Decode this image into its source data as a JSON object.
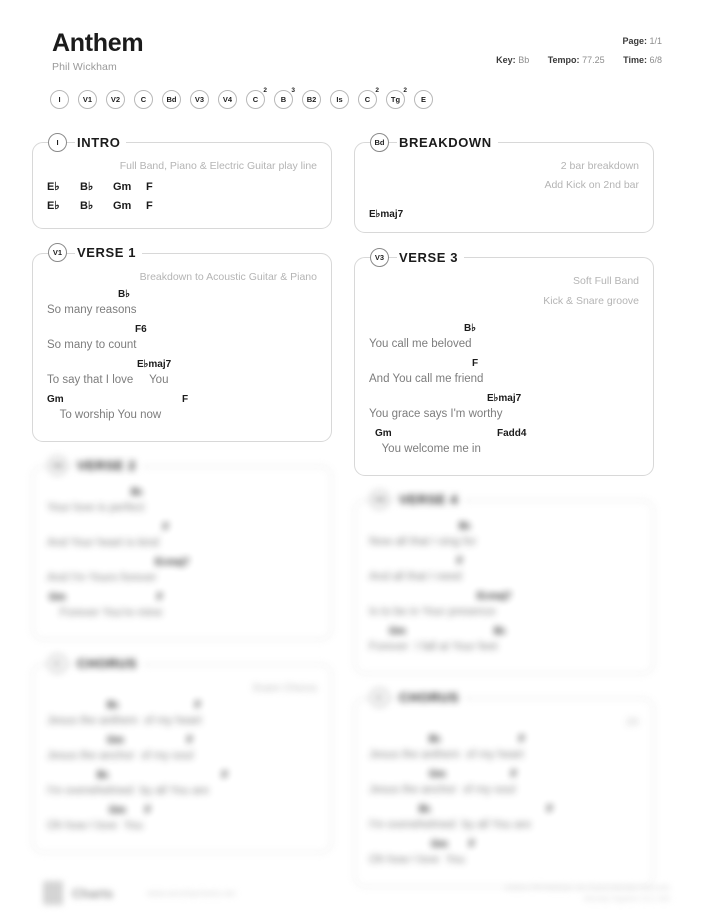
{
  "header": {
    "title": "Anthem",
    "artist": "Phil Wickham",
    "page_label": "Page:",
    "page_value": "1/1",
    "key_label": "Key:",
    "key_value": "Bb",
    "tempo_label": "Tempo:",
    "tempo_value": "77.25",
    "time_label": "Time:",
    "time_value": "6/8"
  },
  "badge_strip": [
    {
      "label": "I",
      "sup": ""
    },
    {
      "label": "V1",
      "sup": ""
    },
    {
      "label": "V2",
      "sup": ""
    },
    {
      "label": "C",
      "sup": ""
    },
    {
      "label": "Bd",
      "sup": ""
    },
    {
      "label": "V3",
      "sup": ""
    },
    {
      "label": "V4",
      "sup": ""
    },
    {
      "label": "C",
      "sup": "2"
    },
    {
      "label": "B",
      "sup": "3"
    },
    {
      "label": "B2",
      "sup": ""
    },
    {
      "label": "Is",
      "sup": ""
    },
    {
      "label": "C",
      "sup": "2"
    },
    {
      "label": "Tg",
      "sup": "2"
    },
    {
      "label": "E",
      "sup": ""
    }
  ],
  "sections": {
    "intro": {
      "badge": "I",
      "title": "INTRO",
      "note": "Full Band, Piano & Electric Guitar play line",
      "chord_rows": [
        [
          "E♭",
          "B♭",
          "Gm",
          "F"
        ],
        [
          "E♭",
          "B♭",
          "Gm",
          "F"
        ]
      ]
    },
    "breakdown": {
      "badge": "Bd",
      "title": "BREAKDOWN",
      "note_line1": "2 bar breakdown",
      "note_line2": "Add Kick on 2nd bar",
      "chord": "E♭maj7"
    },
    "verse1": {
      "badge": "V1",
      "title": "VERSE 1",
      "note": "Breakdown to Acoustic Guitar & Piano",
      "lines": [
        {
          "lyric": "So many reasons",
          "chords": [
            {
              "text": "B♭",
              "offset": 71
            }
          ]
        },
        {
          "lyric": "So many to count",
          "chords": [
            {
              "text": "F6",
              "offset": 88
            }
          ]
        },
        {
          "lyric": "To say that I love     You",
          "chords": [
            {
              "text": "E♭maj7",
              "offset": 90
            }
          ]
        },
        {
          "lyric": "    To worship You now",
          "chords": [
            {
              "text": "Gm",
              "offset": 0
            },
            {
              "text": "F",
              "offset": 135
            }
          ]
        }
      ]
    },
    "verse3": {
      "badge": "V3",
      "title": "VERSE 3",
      "note_line1": "Soft Full Band",
      "note_line2": "Kick & Snare groove",
      "lines": [
        {
          "lyric": "You call me beloved",
          "chords": [
            {
              "text": "B♭",
              "offset": 95
            }
          ]
        },
        {
          "lyric": "And You call me friend",
          "chords": [
            {
              "text": "F",
              "offset": 103
            }
          ]
        },
        {
          "lyric": "You grace says I'm worthy",
          "chords": [
            {
              "text": "E♭maj7",
              "offset": 118
            }
          ]
        },
        {
          "lyric": "    You welcome me in",
          "chords": [
            {
              "text": "Gm",
              "offset": 6
            },
            {
              "text": "Fadd4",
              "offset": 128
            }
          ]
        }
      ]
    },
    "verse2": {
      "badge": "V2",
      "title": "VERSE 2",
      "note": "",
      "lines": [
        {
          "lyric": "Your love is perfect",
          "chords": [
            {
              "text": "B♭",
              "offset": 84
            }
          ]
        },
        {
          "lyric": "And Your heart is kind",
          "chords": [
            {
              "text": "F",
              "offset": 116
            }
          ]
        },
        {
          "lyric": "And I'm Yours forever",
          "chords": [
            {
              "text": "E♭maj7",
              "offset": 108
            }
          ]
        },
        {
          "lyric": "    Forever You're mine",
          "chords": [
            {
              "text": "Gm",
              "offset": 2
            },
            {
              "text": "F",
              "offset": 110
            }
          ]
        }
      ]
    },
    "verse4": {
      "badge": "V4",
      "title": "VERSE 4",
      "note": "",
      "lines": [
        {
          "lyric": "Now all that I sing for",
          "chords": [
            {
              "text": "B♭",
              "offset": 90
            }
          ]
        },
        {
          "lyric": "And all that I need",
          "chords": [
            {
              "text": "F",
              "offset": 88
            }
          ]
        },
        {
          "lyric": "Is to be in Your presence",
          "chords": [
            {
              "text": "E♭maj7",
              "offset": 108
            }
          ]
        },
        {
          "lyric": "Forever  I fall at Your feet",
          "chords": [
            {
              "text": "Gm",
              "offset": 20
            },
            {
              "text": "B♭",
              "offset": 125
            }
          ]
        }
      ]
    },
    "chorus1": {
      "badge": "C",
      "title": "CHORUS",
      "note": "Snare Chorus",
      "lines": [
        {
          "lyric": "Jesus the anthem  of my heart",
          "chords": [
            {
              "text": "B♭",
              "offset": 60
            },
            {
              "text": "F",
              "offset": 148
            }
          ]
        },
        {
          "lyric": "Jesus the anchor  of my soul",
          "chords": [
            {
              "text": "Gm",
              "offset": 60
            },
            {
              "text": "F",
              "offset": 140
            }
          ]
        },
        {
          "lyric": "I'm overwhelmed  by all You are",
          "chords": [
            {
              "text": "B♭",
              "offset": 50
            },
            {
              "text": "F",
              "offset": 175
            }
          ]
        },
        {
          "lyric": "Oh how I love  You",
          "chords": [
            {
              "text": "Gm",
              "offset": 62
            },
            {
              "text": "F",
              "offset": 98
            }
          ]
        }
      ]
    },
    "chorus2": {
      "badge": "C",
      "title": "CHORUS",
      "note": "2X",
      "lines": [
        {
          "lyric": "Jesus the anthem  of my heart",
          "chords": [
            {
              "text": "B♭",
              "offset": 60
            },
            {
              "text": "F",
              "offset": 150
            }
          ]
        },
        {
          "lyric": "Jesus the anchor  of my soul",
          "chords": [
            {
              "text": "Gm",
              "offset": 60
            },
            {
              "text": "F",
              "offset": 142
            }
          ]
        },
        {
          "lyric": "I'm overwhelmed  by all You are",
          "chords": [
            {
              "text": "B♭",
              "offset": 50
            },
            {
              "text": "F",
              "offset": 178
            }
          ]
        },
        {
          "lyric": "Oh how I love  You",
          "chords": [
            {
              "text": "Gm",
              "offset": 62
            },
            {
              "text": "F",
              "offset": 100
            }
          ]
        }
      ]
    }
  },
  "footer": {
    "logo_text": "Charts",
    "url": "www.worshipcharts.net",
    "credit_line1": "Anthem  Phil Wickham  Jon Guerra  Brandon Reynolds",
    "credit_line2": "Worship Together  CCLI 000"
  },
  "colors": {
    "text": "#1b1b1b",
    "muted": "#7d7d7d",
    "note": "#b4b4b4",
    "border": "#d8d8d8",
    "badge_border": "#b8b8b8"
  }
}
